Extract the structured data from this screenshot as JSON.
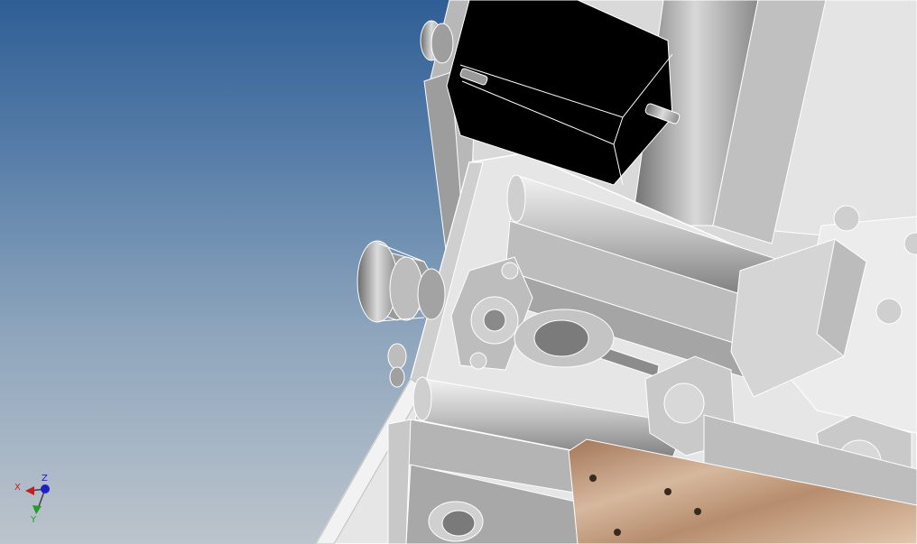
{
  "viewport": {
    "background_top": "#2f5e95",
    "background_bottom": "#bcc4cc",
    "model_face_color": "#c9c9c9",
    "motor_color": "#000000",
    "plate_color": "#b58a6a"
  },
  "triad": {
    "x_label": "X",
    "y_label": "Y",
    "z_label": "Z",
    "x_color": "#c02020",
    "y_color": "#20a020",
    "z_color": "#2020c0"
  }
}
